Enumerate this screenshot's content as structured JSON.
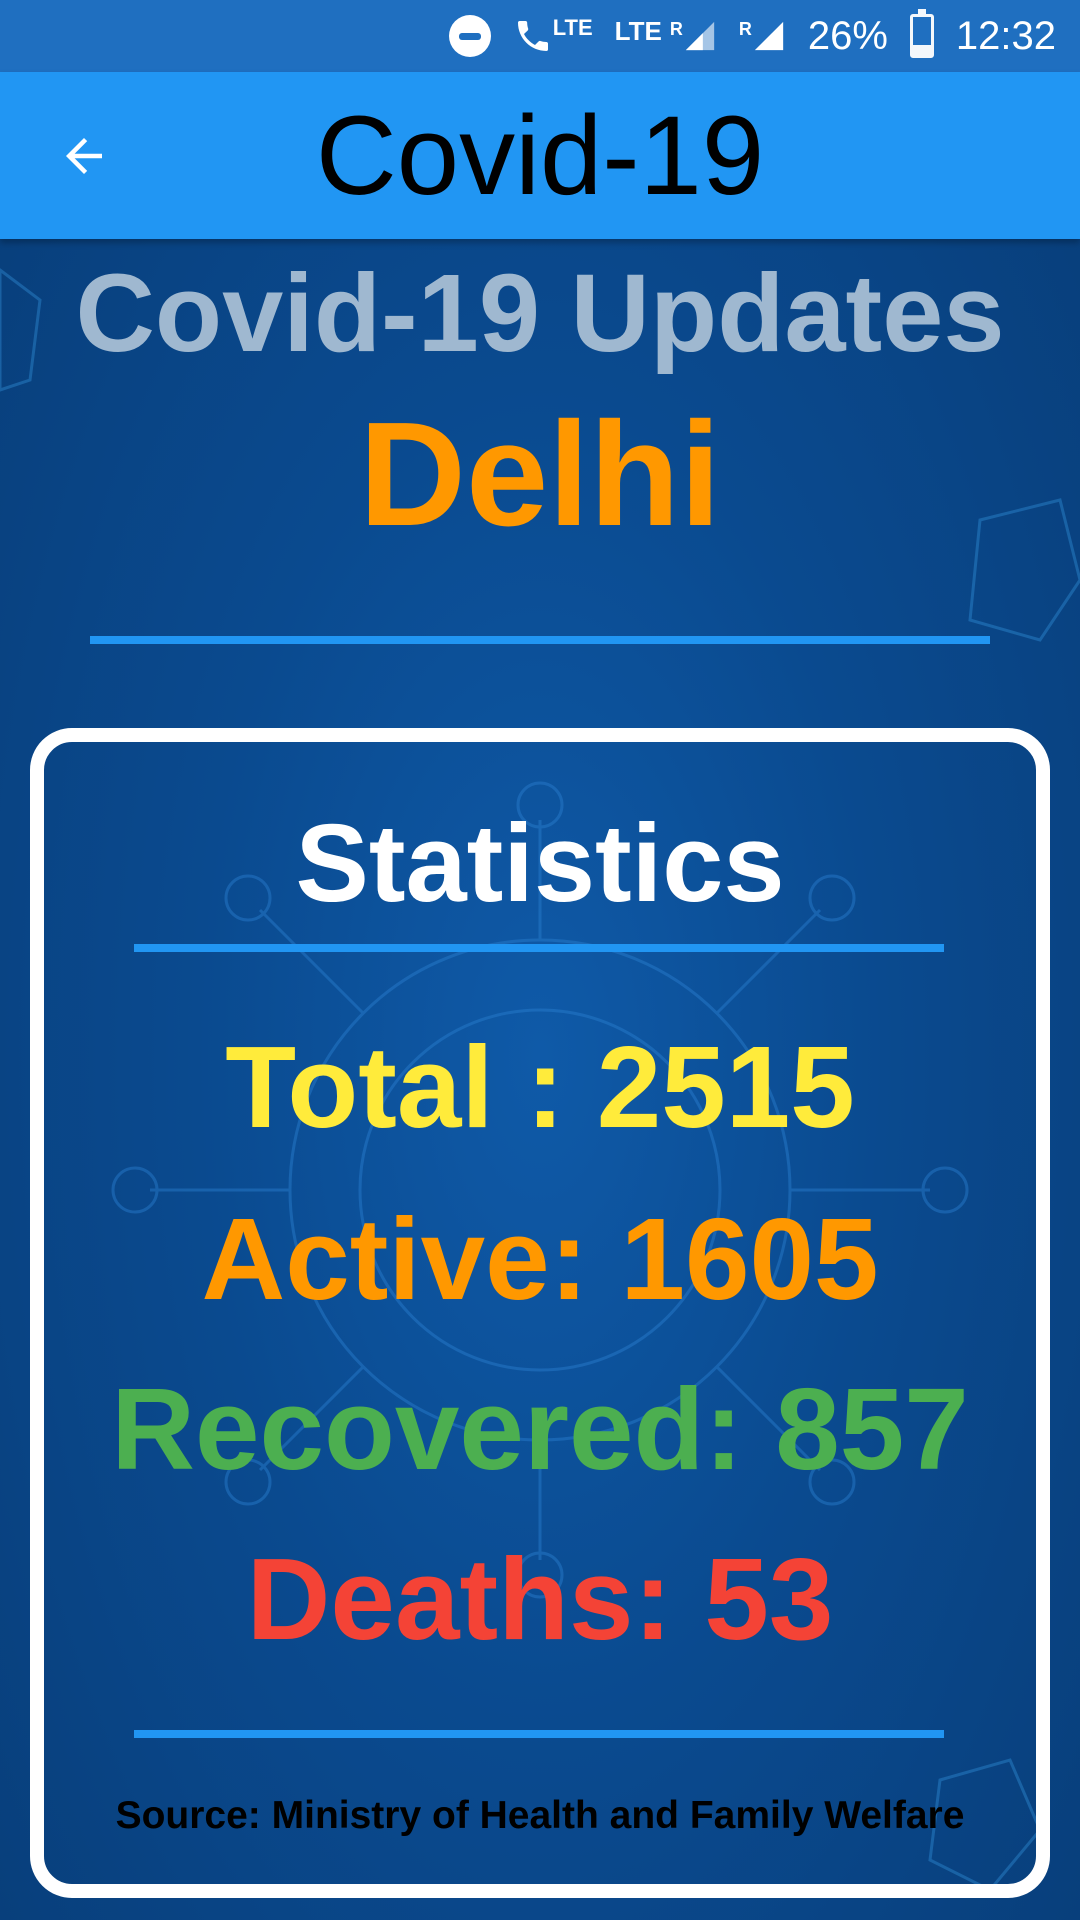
{
  "status_bar": {
    "lte_call": "LTE",
    "lte": "LTE",
    "roaming_1": "R",
    "roaming_2": "R",
    "battery": "26%",
    "time": "12:32",
    "battery_level": 0.26
  },
  "app_bar": {
    "title": "Covid-19",
    "back_icon": "arrow-left-icon"
  },
  "headings": {
    "updates": "Covid-19 Updates",
    "region": "Delhi"
  },
  "statistics": {
    "title": "Statistics",
    "total": "Total : 2515",
    "active": "Active: 1605",
    "recovered": "Recovered: 857",
    "deaths": "Deaths: 53",
    "source": "Source: Ministry of Health and Family Welfare"
  },
  "colors": {
    "app_bar": "#2196f3",
    "status_bar": "#1f6fc0",
    "background": "#0a4a8f",
    "region": "#ff9800",
    "total": "#ffeb3b",
    "active": "#ff9800",
    "recovered": "#4caf50",
    "deaths": "#f44336"
  }
}
